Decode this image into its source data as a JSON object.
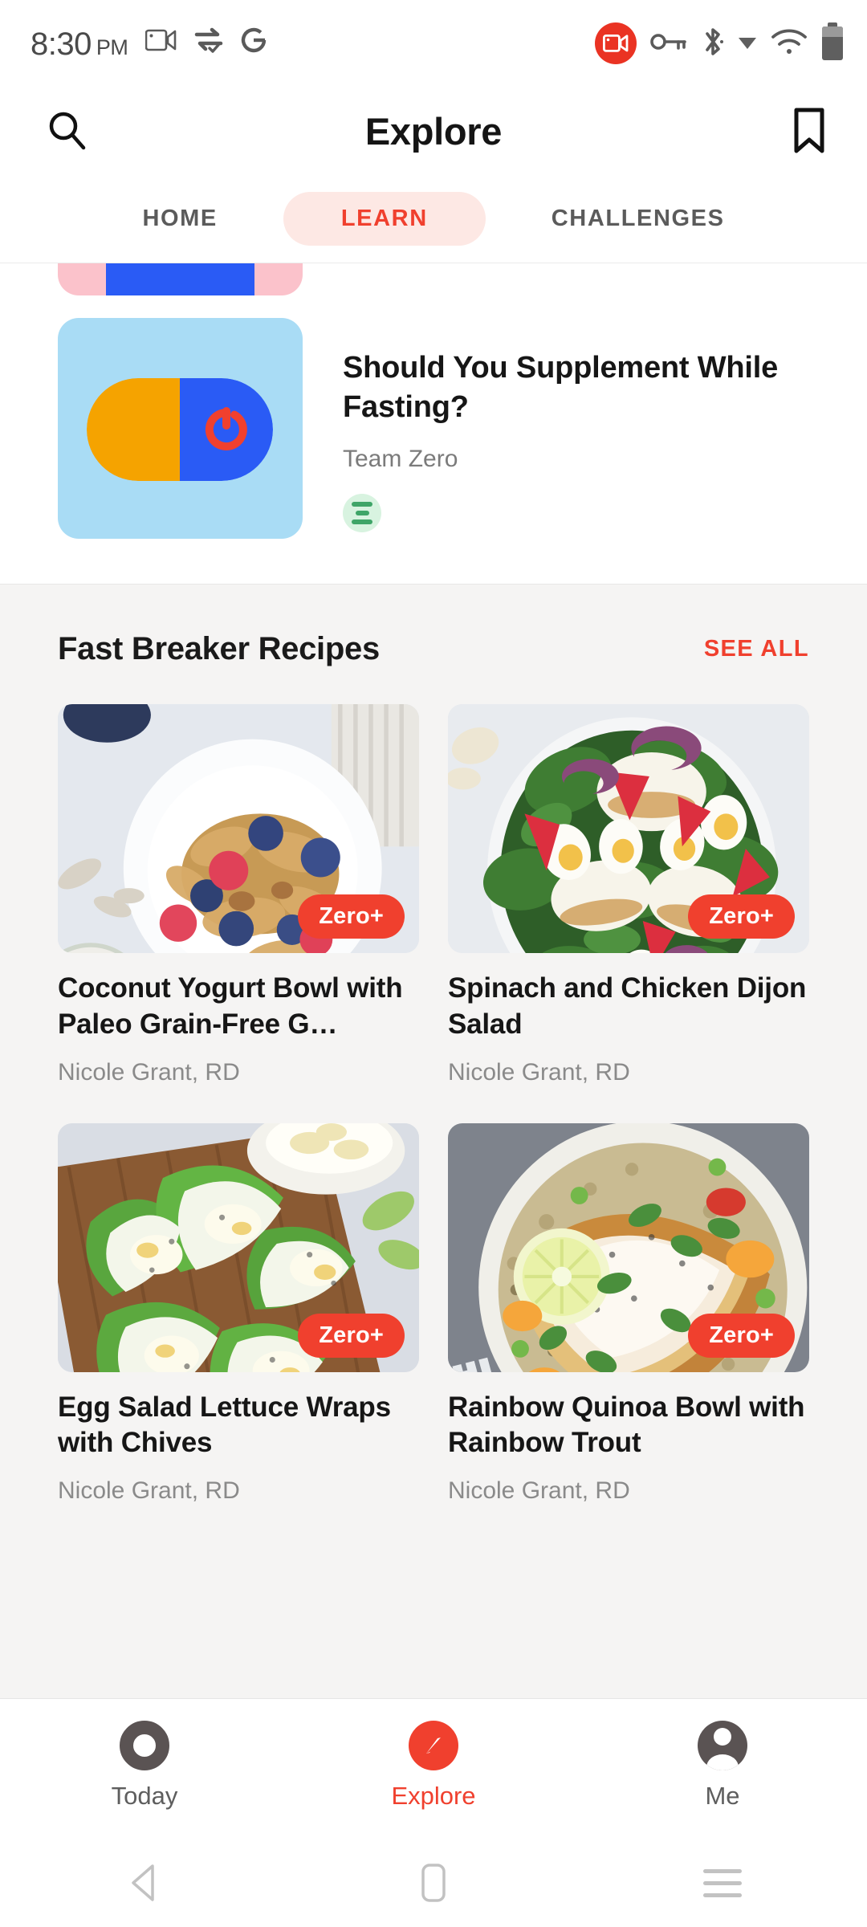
{
  "status_bar": {
    "time": "8:30",
    "ampm": "PM",
    "left_icons": [
      "video-camera-icon",
      "sync-transfer-icon",
      "google-g-icon"
    ],
    "right_icons": [
      "screen-recording-icon",
      "vpn-key-icon",
      "bluetooth-icon",
      "wifi-icon",
      "battery-icon"
    ],
    "accent_red": "#EA3323"
  },
  "header": {
    "title": "Explore",
    "search_icon": "search-icon",
    "bookmark_icon": "bookmark-icon"
  },
  "tabs": {
    "items": [
      {
        "label": "HOME",
        "active": false
      },
      {
        "label": "LEARN",
        "active": true
      },
      {
        "label": "CHALLENGES",
        "active": false
      }
    ],
    "active_color": "#F0402E",
    "active_bg": "#FDE8E4"
  },
  "article": {
    "title": "Should You Supplement While Fasting?",
    "author": "Team Zero",
    "badge_icon": "article-lines-icon",
    "thumb_icon": "supplement-pill-icon"
  },
  "recipes_section": {
    "title": "Fast Breaker Recipes",
    "see_all_label": "SEE ALL",
    "see_all_color": "#F0402E",
    "badge_label": "Zero+",
    "badge_color": "#F0402E",
    "items": [
      {
        "title": "Coconut Yogurt Bowl with Paleo Grain-Free G…",
        "author": "Nicole Grant, RD",
        "badge": "Zero+",
        "image": "coconut-yogurt-bowl-photo"
      },
      {
        "title": "Spinach and Chicken Dijon Salad",
        "author": "Nicole Grant, RD",
        "badge": "Zero+",
        "image": "spinach-chicken-salad-photo"
      },
      {
        "title": "Egg Salad Lettuce Wraps with Chives",
        "author": "Nicole Grant, RD",
        "badge": "Zero+",
        "image": "egg-salad-lettuce-wraps-photo"
      },
      {
        "title": "Rainbow Quinoa Bowl with Rainbow Trout",
        "author": "Nicole Grant, RD",
        "badge": "Zero+",
        "image": "rainbow-quinoa-trout-photo"
      }
    ]
  },
  "bottom_nav": {
    "items": [
      {
        "label": "Today",
        "icon": "ring-timer-icon",
        "active": false
      },
      {
        "label": "Explore",
        "icon": "compass-icon",
        "active": true
      },
      {
        "label": "Me",
        "icon": "person-icon",
        "active": false
      }
    ],
    "active_color": "#F0402E"
  },
  "system_nav": {
    "back_icon": "back-triangle-icon",
    "home_icon": "home-square-icon",
    "recents_icon": "recents-lines-icon"
  }
}
